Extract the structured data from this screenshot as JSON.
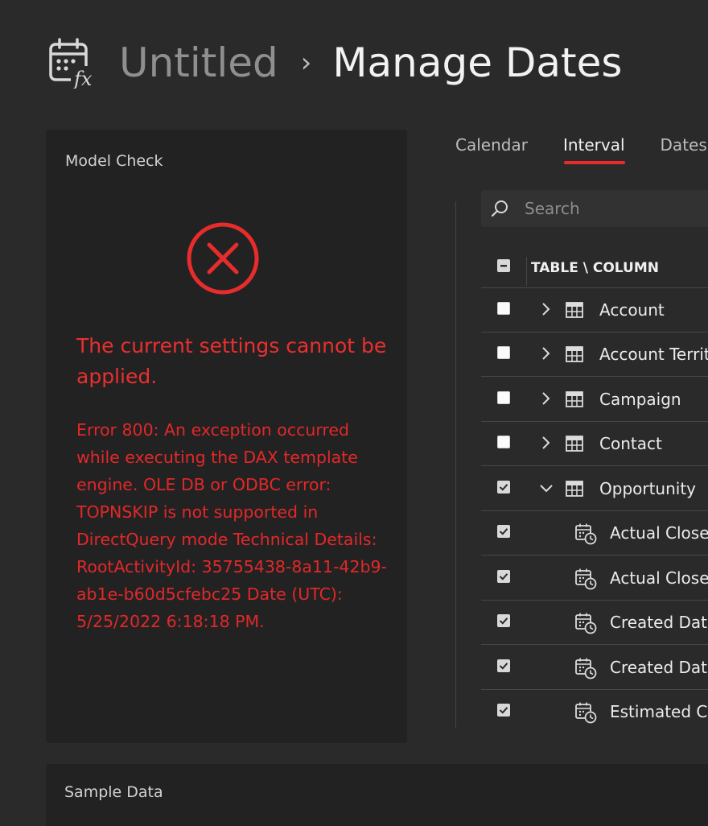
{
  "header": {
    "breadcrumb_root": "Untitled",
    "separator": "›",
    "title": "Manage Dates",
    "icon": "calendar-fx-icon"
  },
  "model_check": {
    "title": "Model Check",
    "status_icon": "error-x-circle-icon",
    "heading": "The current settings cannot be applied.",
    "message": "Error 800: An exception occurred while executing the DAX template engine. OLE DB or ODBC error: TOPNSKIP is not supported in DirectQuery mode Technical Details: RootActivityId: 35755438-8a11-42b9-ab1e-b60d5cfebc25 Date (UTC): 5/25/2022 6:18:18 PM."
  },
  "tabs": [
    {
      "label": "Calendar",
      "active": false
    },
    {
      "label": "Interval",
      "active": true
    },
    {
      "label": "Dates",
      "active": false
    }
  ],
  "search": {
    "placeholder": "Search",
    "value": ""
  },
  "table": {
    "header": "TABLE \\ COLUMN",
    "rows": [
      {
        "label": "Account",
        "type": "table",
        "checked": false,
        "expanded": false
      },
      {
        "label": "Account Territo",
        "type": "table",
        "checked": false,
        "expanded": false
      },
      {
        "label": "Campaign",
        "type": "table",
        "checked": false,
        "expanded": false
      },
      {
        "label": "Contact",
        "type": "table",
        "checked": false,
        "expanded": false
      },
      {
        "label": "Opportunity",
        "type": "table",
        "checked": true,
        "expanded": true
      },
      {
        "label": "Actual Close",
        "type": "column",
        "checked": true
      },
      {
        "label": "Actual Close",
        "type": "column",
        "checked": true
      },
      {
        "label": "Created Date",
        "type": "column",
        "checked": true
      },
      {
        "label": "Created Date",
        "type": "column",
        "checked": true
      },
      {
        "label": "Estimated Clo",
        "type": "column",
        "checked": true
      }
    ]
  },
  "sample_data": {
    "title": "Sample Data"
  },
  "colors": {
    "background": "#2b2a2b",
    "panel": "#232223",
    "error": "#e82c2c",
    "accent": "#e82c2c"
  }
}
